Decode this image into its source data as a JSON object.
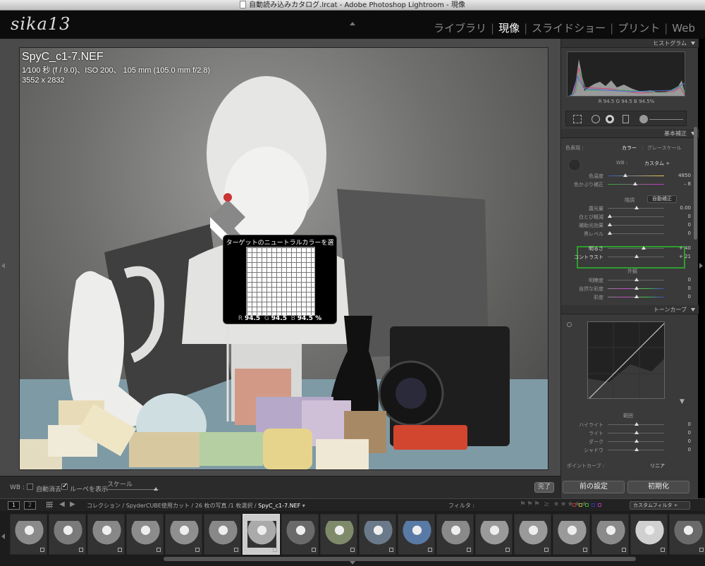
{
  "window": {
    "title": "自動読み込みカタログ.lrcat - Adobe Photoshop Lightroom - 現像"
  },
  "logo": "sika13",
  "modules": [
    {
      "label": "ライブラリ",
      "active": false
    },
    {
      "label": "現像",
      "active": true
    },
    {
      "label": "スライドショー",
      "active": false
    },
    {
      "label": "プリント",
      "active": false
    },
    {
      "label": "Web",
      "active": false
    }
  ],
  "photo": {
    "filename": "SpyC_c1-7.NEF",
    "exposure": "1⁄100 秒 (f / 9.0)、ISO 200、 105 mm (105.0 mm f/2.8)",
    "dimensions": "3552 x 2832"
  },
  "loupe": {
    "title": "ターゲットのニュートラルカラーを選択",
    "r_label": "R",
    "r_value": "94.5",
    "g_label": "G",
    "g_value": "94.5",
    "b_label": "B",
    "b_value": "94.5 %"
  },
  "toolbar": {
    "wb_label": "WB :",
    "auto_dismiss_label": "自動消去",
    "auto_dismiss_checked": false,
    "show_loupe_label": "ルーペを表示",
    "show_loupe_checked": true,
    "scale_label": "スケール",
    "done_label": "完了"
  },
  "histogram": {
    "header": "ヒストグラム",
    "readout": "R  94.5  G  94.5  B  94.5%"
  },
  "basic": {
    "header": "基本補正",
    "treatment_label": "色表現 :",
    "treatment_color": "カラー",
    "treatment_gray": "グレースケール",
    "wb_label": "WB :",
    "wb_value": "カスタム ÷",
    "temp_label": "色温度",
    "temp_value": "4850",
    "tint_label": "色かぶり補正",
    "tint_value": "– 8",
    "tone_label": "階調",
    "auto_tone_label": "自動補正",
    "exposure_label": "露光量",
    "exposure_value": "0.00",
    "recovery_label": "白とび軽減",
    "recovery_value": "0",
    "fill_label": "補助光効果",
    "fill_value": "0",
    "blacks_label": "黒レベル",
    "blacks_value": "0",
    "brightness_label": "明るさ",
    "brightness_value": "+ 40",
    "contrast_label": "コントラスト",
    "contrast_value": "+ 21",
    "presence_label": "外観",
    "clarity_label": "明瞭度",
    "clarity_value": "0",
    "vibrance_label": "自然な彩度",
    "vibrance_value": "0",
    "saturation_label": "彩度",
    "saturation_value": "0"
  },
  "tonecurve": {
    "header": "トーンカーブ",
    "region_label": "範囲",
    "highlights_label": "ハイライト",
    "highlights_value": "0",
    "lights_label": "ライト",
    "lights_value": "0",
    "darks_label": "ダーク",
    "darks_value": "0",
    "shadows_label": "シャドウ",
    "shadows_value": "0",
    "point_curve_label": "ポイントカーブ :",
    "point_curve_value": "リニア"
  },
  "panel_buttons": {
    "previous": "前の設定",
    "reset": "初期化"
  },
  "filmbar": {
    "page1": "1",
    "page2": "2",
    "breadcrumb_prefix": "コレクション / SpyderCUBE使用カット / 26 枚の写真 /1 枚選択 /",
    "breadcrumb_file": "SpyC_c1-7.NEF",
    "filter_label": "フィルタ :",
    "filter_value": "カスタムフィルタ ÷"
  },
  "colors": {
    "accent_highlight": "#2f9e2f",
    "panel_bg": "#3a3a3a",
    "active_module": "#ffffff"
  },
  "filmstrip": {
    "count": 18,
    "selected_index": 6
  }
}
